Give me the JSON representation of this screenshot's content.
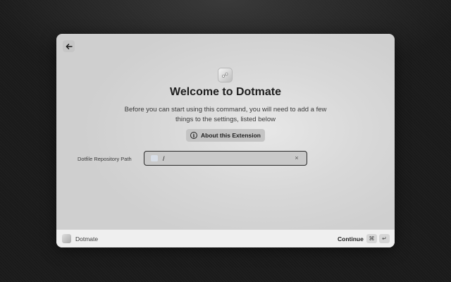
{
  "window": {
    "back_icon": "arrow-left-icon",
    "extension_icon": "dotmate-icon",
    "title": "Welcome to Dotmate",
    "description": "Before you can start using this command, you will need to add a few things to the settings, listed below",
    "about_button": {
      "label": "About this Extension",
      "icon": "info-icon"
    }
  },
  "form": {
    "fields": [
      {
        "label": "Dotfile Repository Path",
        "value": "/",
        "clear_icon": "clear-icon",
        "clear_glyph": "×"
      }
    ]
  },
  "footer": {
    "extension_name": "Dotmate",
    "action_label": "Continue",
    "shortcut_keys": [
      "⌘",
      "↵"
    ]
  }
}
